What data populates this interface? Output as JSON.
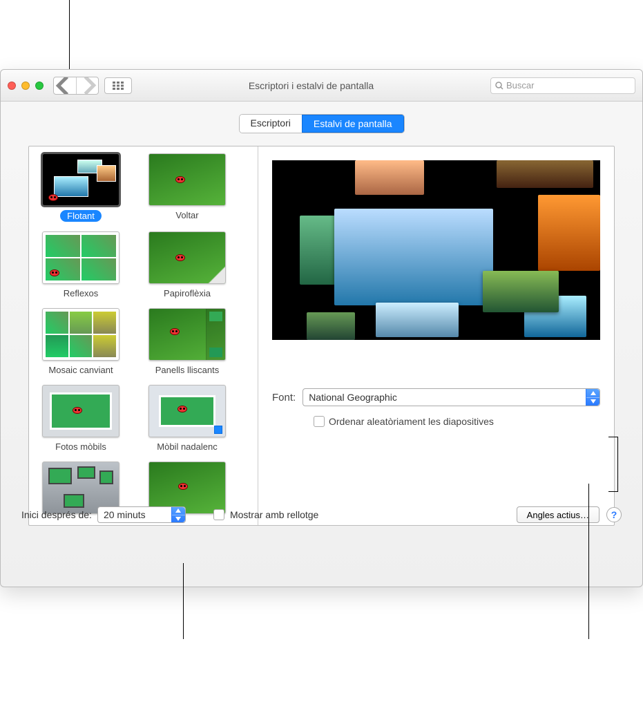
{
  "window": {
    "title": "Escriptori i estalvi de pantalla"
  },
  "search": {
    "placeholder": "Buscar"
  },
  "tabs": {
    "desktop": "Escriptori",
    "screensaver": "Estalvi de pantalla"
  },
  "screensavers": [
    {
      "label": "Flotant"
    },
    {
      "label": "Voltar"
    },
    {
      "label": "Reflexos"
    },
    {
      "label": "Papiroflèxia"
    },
    {
      "label": "Mosaic canviant"
    },
    {
      "label": "Panells lliscants"
    },
    {
      "label": "Fotos mòbils"
    },
    {
      "label": "Mòbil nadalenc"
    }
  ],
  "source": {
    "label": "Font:",
    "value": "National Geographic"
  },
  "random": {
    "label": "Ordenar aleatòriament les diapositives"
  },
  "start": {
    "label": "Inici després de:",
    "value": "20 minuts"
  },
  "clock": {
    "label": "Mostrar amb rellotge"
  },
  "hotcorners": {
    "label": "Angles actius…"
  }
}
